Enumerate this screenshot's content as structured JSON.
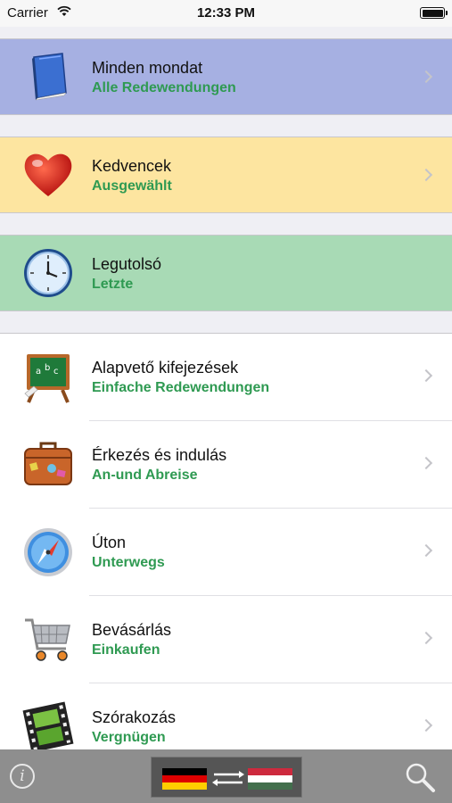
{
  "status_bar": {
    "carrier": "Carrier",
    "time": "12:33 PM",
    "battery_level": 1.0
  },
  "categories": [
    {
      "title": "Minden mondat",
      "subtitle": "Alle Redewendungen",
      "icon": "book-icon",
      "background": "#a6b0e2"
    },
    {
      "title": "Kedvencek",
      "subtitle": "Ausgewählt",
      "icon": "heart-icon",
      "background": "#fde5a0"
    },
    {
      "title": "Legutolsó",
      "subtitle": "Letzte",
      "icon": "clock-icon",
      "background": "#a8dab5"
    }
  ],
  "list": [
    {
      "title": "Alapvető kifejezések",
      "subtitle": "Einfache Redewendungen",
      "icon": "chalkboard-icon"
    },
    {
      "title": "Érkezés és indulás",
      "subtitle": "An-und Abreise",
      "icon": "suitcase-icon"
    },
    {
      "title": "Úton",
      "subtitle": "Unterwegs",
      "icon": "compass-icon"
    },
    {
      "title": "Bevásárlás",
      "subtitle": "Einkaufen",
      "icon": "shopping-cart-icon"
    },
    {
      "title": "Szórakozás",
      "subtitle": "Vergnügen",
      "icon": "film-strip-icon"
    }
  ],
  "toolbar": {
    "info_glyph": "i",
    "source_language": "German",
    "target_language": "Hungarian"
  },
  "colors": {
    "subtitle_green": "#2f9a52",
    "toolbar_gray": "#8e8e8e"
  }
}
